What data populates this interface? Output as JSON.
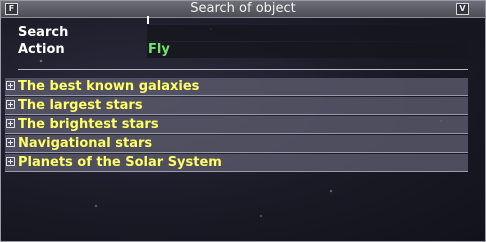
{
  "window": {
    "title": "Search of object",
    "left_button_glyph": "F",
    "right_button_glyph": "V"
  },
  "form": {
    "search_label": "Search",
    "search_value": "",
    "action_label": "Action",
    "action_value": "Fly"
  },
  "categories": [
    {
      "label": "The best known galaxies",
      "expander_icon": "plus-box-icon"
    },
    {
      "label": "The largest stars",
      "expander_icon": "plus-box-icon"
    },
    {
      "label": "The brightest stars",
      "expander_icon": "plus-box-icon"
    },
    {
      "label": "Navigational stars",
      "expander_icon": "plus-box-icon"
    },
    {
      "label": "Planets of the Solar System",
      "expander_icon": "plus-box-icon"
    }
  ],
  "colors": {
    "title_text": "#f2f2f2",
    "label_text": "#ffffff",
    "action_value_text": "#6fe36f",
    "category_text": "#ffff66"
  }
}
